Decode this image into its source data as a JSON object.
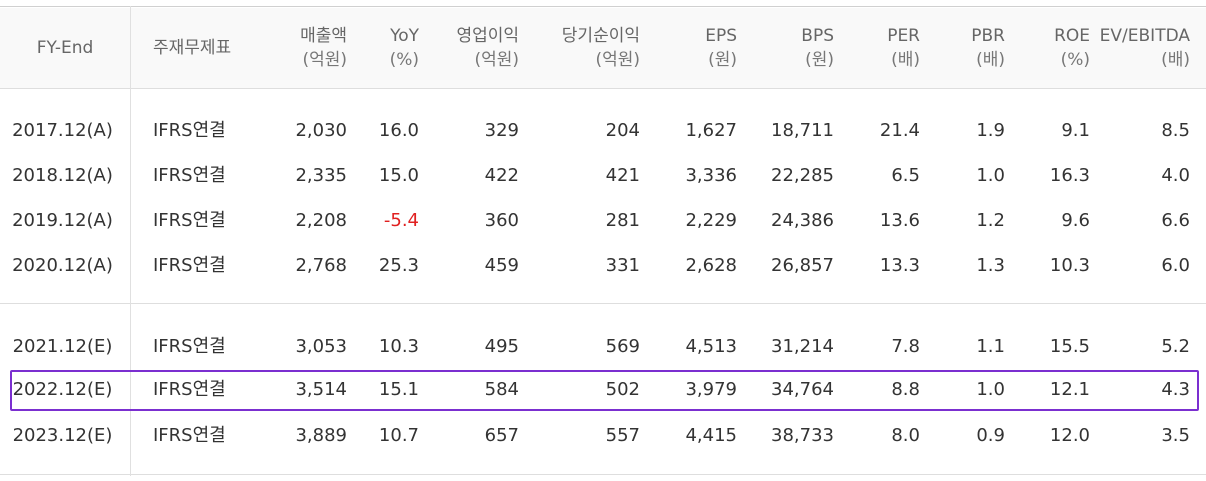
{
  "table": {
    "headers": [
      {
        "label": "FY-End",
        "unit": ""
      },
      {
        "label": "주재무제표",
        "unit": ""
      },
      {
        "label": "매출액",
        "unit": "(억원)"
      },
      {
        "label": "YoY",
        "unit": "(%)"
      },
      {
        "label": "영업이익",
        "unit": "(억원)"
      },
      {
        "label": "당기순이익",
        "unit": "(억원)"
      },
      {
        "label": "EPS",
        "unit": "(원)"
      },
      {
        "label": "BPS",
        "unit": "(원)"
      },
      {
        "label": "PER",
        "unit": "(배)"
      },
      {
        "label": "PBR",
        "unit": "(배)"
      },
      {
        "label": "ROE",
        "unit": "(%)"
      },
      {
        "label": "EV/EBITDA",
        "unit": "(배)"
      }
    ],
    "rows": [
      [
        "2017.12(A)",
        "IFRS연결",
        "2,030",
        "16.0",
        "329",
        "204",
        "1,627",
        "18,711",
        "21.4",
        "1.9",
        "9.1",
        "8.5"
      ],
      [
        "2018.12(A)",
        "IFRS연결",
        "2,335",
        "15.0",
        "422",
        "421",
        "3,336",
        "22,285",
        "6.5",
        "1.0",
        "16.3",
        "4.0"
      ],
      [
        "2019.12(A)",
        "IFRS연결",
        "2,208",
        "-5.4",
        "360",
        "281",
        "2,229",
        "24,386",
        "13.6",
        "1.2",
        "9.6",
        "6.6"
      ],
      [
        "2020.12(A)",
        "IFRS연결",
        "2,768",
        "25.3",
        "459",
        "331",
        "2,628",
        "26,857",
        "13.3",
        "1.3",
        "10.3",
        "6.0"
      ],
      [
        "2021.12(E)",
        "IFRS연결",
        "3,053",
        "10.3",
        "495",
        "569",
        "4,513",
        "31,214",
        "7.8",
        "1.1",
        "15.5",
        "5.2"
      ],
      [
        "2022.12(E)",
        "IFRS연결",
        "3,514",
        "15.1",
        "584",
        "502",
        "3,979",
        "34,764",
        "8.8",
        "1.0",
        "12.1",
        "4.3"
      ],
      [
        "2023.12(E)",
        "IFRS연결",
        "3,889",
        "10.7",
        "657",
        "557",
        "4,415",
        "38,733",
        "8.0",
        "0.9",
        "12.0",
        "3.5"
      ]
    ],
    "highlighted_row": "2022.12(E)",
    "colors": {
      "negative": "#e02020",
      "highlight_border": "#7b2fd0"
    }
  }
}
